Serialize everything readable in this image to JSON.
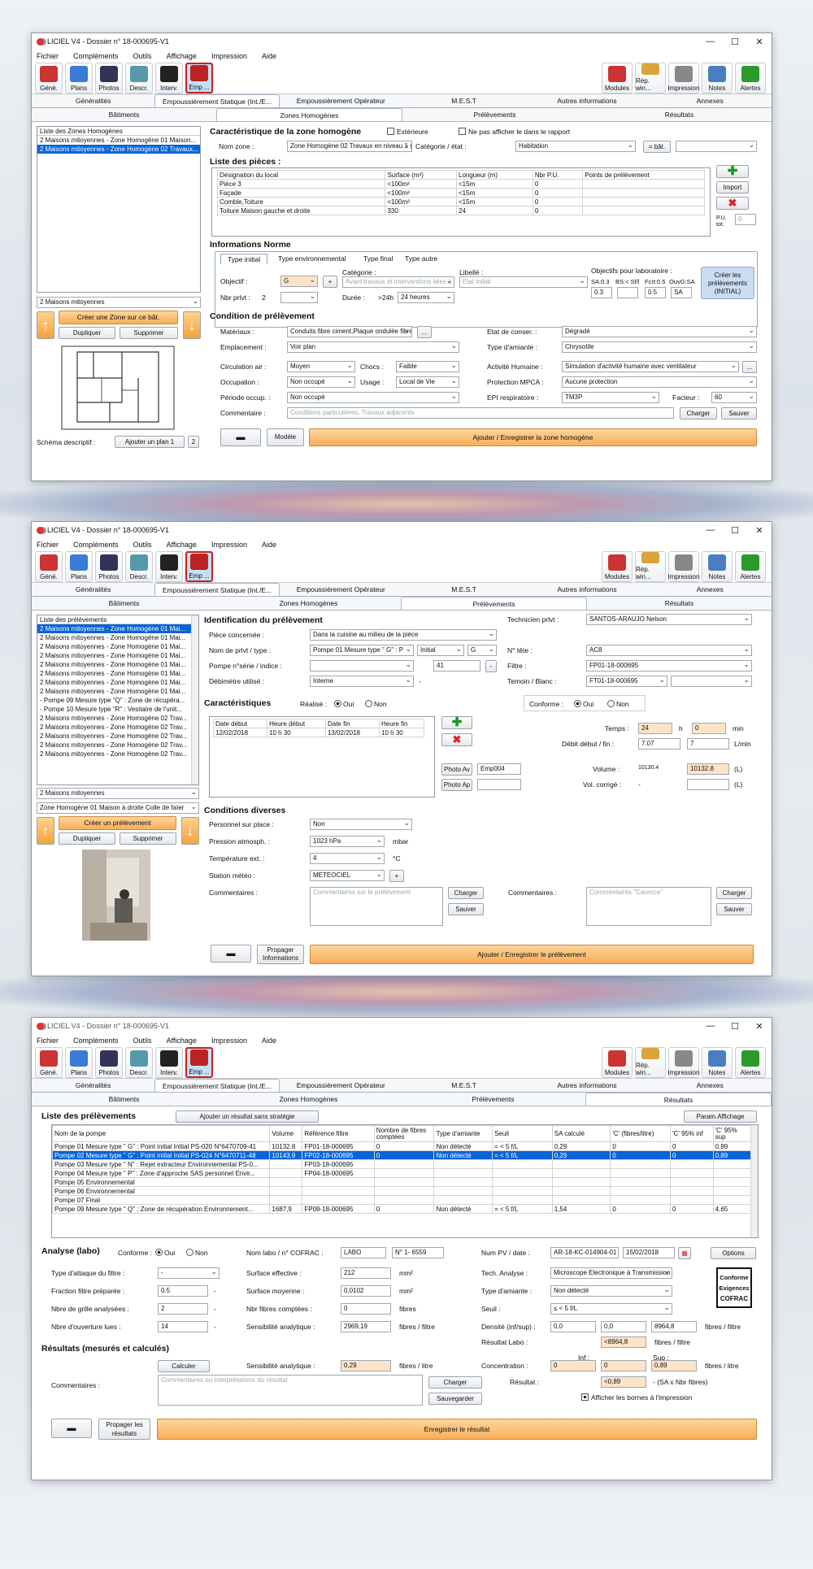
{
  "app": {
    "title": "LICIEL V4 - Dossier n° 18-000695-V1",
    "win_min": "—",
    "win_max": "☐",
    "win_close": "✕",
    "menu": [
      "Fichier",
      "Compléments",
      "Outils",
      "Affichage",
      "Impression",
      "Aide"
    ],
    "toolbar_left": [
      {
        "label": "Géné.",
        "icon": "house-icon",
        "color": "#c33"
      },
      {
        "label": "Plans",
        "icon": "plans-icon",
        "color": "#3a7bd5"
      },
      {
        "label": "Photos",
        "icon": "camera-icon",
        "color": "#335"
      },
      {
        "label": "Descr.",
        "icon": "descr-icon",
        "color": "#59a"
      },
      {
        "label": "Interv.",
        "icon": "phone-icon",
        "color": "#222"
      },
      {
        "label": "Emp ...",
        "icon": "emp-icon",
        "color": "#b22"
      }
    ],
    "toolbar_right": [
      {
        "label": "Modules",
        "icon": "modules-icon",
        "color": "#c33"
      },
      {
        "label": "Rép. win...",
        "icon": "folder-icon",
        "color": "#d9a43a"
      },
      {
        "label": "Impression",
        "icon": "printer-icon",
        "color": "#888"
      },
      {
        "label": "Notes",
        "icon": "notes-icon",
        "color": "#4a7ec0"
      },
      {
        "label": "Alertes",
        "icon": "alert-icon",
        "color": "#2a9a2a"
      }
    ],
    "tabs_main": [
      "Généralités",
      "Empoussièrement Statique (Int./E...",
      "Empoussièrement Opérateur",
      "M.E.S.T",
      "Autres informations",
      "Annexes"
    ],
    "tabs_main3": [
      "Généralités",
      "Empoussièrement Statique (Int./E...",
      "Empoussièrement Opérateur",
      "M.E.S.T",
      "Autres informations",
      "Annexes"
    ],
    "tabs_sub": [
      "Bâtiments",
      "Zones Homogènes",
      "Prélèvements",
      "Résultats"
    ]
  },
  "w1": {
    "zones_header": "Liste des Zones Homogènes",
    "zones": [
      "2 Maisons mitoyennes - Zone Homogène 01 Maison...",
      "2 Maisons mitoyennes - Zone Homogène 02 Travaux..."
    ],
    "bat_select": "2 Maisons mitoyennes",
    "btn_create": "Créer une Zone sur ce bât.",
    "btn_dup": "Dupliquer",
    "btn_del": "Supprimer",
    "schema_label": "Schéma descriptif :",
    "btn_plan": "Ajouter un plan 1",
    "plan_n": "2",
    "btn_modele": "Modèle",
    "h_zone": "Caractéristique de la zone homogène",
    "chk_ext": "Extérieure",
    "chk_noreport": "Ne pas afficher le dans le rapport",
    "lbl_nom": "Nom zone :",
    "nom": "Zone Homogène 02 Travaux en niveau 1 (Conc",
    "lbl_cat": "Catégorie / état :",
    "cat": "Habitation",
    "btn_eq": "= bât.",
    "h_pieces": "Liste des pièces :",
    "pieces_cols": [
      "Désignation du local",
      "Surface (m²)",
      "Longueur (m)",
      "Nbr P.U.",
      "Points de prélèvement"
    ],
    "pieces": [
      [
        "Pièce 3",
        "<100m²",
        "<15m",
        "0",
        ""
      ],
      [
        "Façade",
        "<100m²",
        "<15m",
        "0",
        ""
      ],
      [
        "Comble,Toiture",
        "<100m²",
        "<15m",
        "0",
        ""
      ],
      [
        "Toiture Maison  gauche et droite",
        "330",
        "24",
        "0",
        ""
      ]
    ],
    "btn_import": "Import",
    "pu_tot_label": "P.U. tot.",
    "pu_tot": "0",
    "h_norme": "Informations Norme",
    "norme_tabs": [
      "Type initial",
      "Type environnemental",
      "Type final",
      "Type autre"
    ],
    "lbl_objectif": "Objectif :",
    "objectif": "G",
    "lbl_categorie": "Catégorie :",
    "categorie": "Avant travaux et interventions liées à",
    "lbl_libelle": "Libellé :",
    "libelle": "Etat initial",
    "lbl_objlab": "Objectifs pour laboratoire :",
    "sa_lbl": "SA:0.3",
    "bs_lbl": "BS:< Sf/l",
    "fct_lbl": "Fcrt:0.5",
    "ouv_lbl": "OuvG:SA",
    "sa": "0.3",
    "bs": "",
    "fct": "0.5",
    "ouv": "SA",
    "lbl_nbr": "Nbr prlvt :",
    "nbr": "2",
    "lbl_duree": "Durée :",
    "duree_pre": ">24h",
    "duree": "24 heures",
    "btn_creer_prelev": "Créer les prélèvements (INITIAL)",
    "h_condition": "Condition de prélèvement",
    "lbl_mat": "Matériaux :",
    "mat": "Conduits fibre ciment,Plaque ondulée fibre cir",
    "lbl_etat": "Etat de conser. :",
    "etat": "Dégradé",
    "lbl_empl": "Emplacement :",
    "empl": "Voir plan",
    "lbl_type_am": "Type d'amiante :",
    "type_am": "Chrysotile",
    "lbl_circ": "Circulation air :",
    "circ": "Moyen",
    "lbl_chocs": "Chocs :",
    "chocs": "Faible",
    "lbl_act": "Activité Humaine :",
    "act": "Simulation d'activité humaine avec ventilateur",
    "lbl_occ": "Occupation :",
    "occ": "Non occupé",
    "lbl_usage": "Usage :",
    "usage": "Local de Vie",
    "lbl_prot": "Protection MPCA :",
    "prot": "Aucune protection",
    "lbl_per": "Période occup. :",
    "per": "Non occupé",
    "lbl_epi": "EPI respiratoire :",
    "epi": "TM3P",
    "lbl_fact": "Facteur :",
    "fact": "60",
    "lbl_comm": "Commentaire :",
    "comm_ph": "Conditions particulières, Travaux adjacents",
    "btn_charger": "Charger",
    "btn_sauver": "Sauver",
    "btn_save_zone": "Ajouter / Enregistrer la zone homogène"
  },
  "w2": {
    "list_header": "Liste des prélèvements",
    "prelevs": [
      "2 Maisons mitoyennes - Zone Homogène 01 Mai...",
      "2 Maisons mitoyennes - Zone Homogène 01 Mai...",
      "2 Maisons mitoyennes - Zone Homogène 01 Mai...",
      "2 Maisons mitoyennes - Zone Homogène 01 Mai...",
      "2 Maisons mitoyennes - Zone Homogène 01 Mai...",
      "2 Maisons mitoyennes - Zone Homogène 01 Mai...",
      "2 Maisons mitoyennes - Zone Homogène 01 Mai...",
      "2 Maisons mitoyennes - Zone Homogène 01 Mai...",
      "- Pompe 09 Mesure type \"Q\" : Zone de récupéra...",
      "- Pompe 10 Mesure type \"R\" : Vestiaire de l'unit...",
      "2 Maisons mitoyennes - Zone Homogène 02 Trav...",
      "2 Maisons mitoyennes - Zone Homogène 02 Trav...",
      "2 Maisons mitoyennes - Zone Homogène 02 Trav...",
      "2 Maisons mitoyennes - Zone Homogène 02 Trav...",
      "2 Maisons mitoyennes - Zone Homogène 02 Trav..."
    ],
    "bat_select": "2 Maisons mitoyennes",
    "zone_select": "Zone Homogène 01 Maison à droite Colle de faïer",
    "btn_create": "Créer un prélèvement",
    "btn_dup": "Dupliquer",
    "btn_del": "Supprimer",
    "btn_propag": "Propager Informations",
    "h_ident": "Identification du prélèvement",
    "lbl_piece": "Pièce concernée :",
    "piece": "Dans la cuisine au milieu de la pièce",
    "lbl_nom": "Nom de prlvt / type :",
    "nom": "Pompe 01 Mesure type \" G\" : P",
    "nom_type": "Initial",
    "nom_g": "G",
    "lbl_pompe": "Pompe n°série / indice :",
    "pompe": "",
    "indice": "41",
    "lbl_debit": "Débimètre utilisé :",
    "debit": "Interne",
    "lbl_tech": "Technicien prlvt :",
    "tech": "SANTOS-ARAUJO Nelson",
    "lbl_tete": "N° tête :",
    "tete": "AC8",
    "lbl_filtre": "Filtre :",
    "filtre": "FP01-18-000695",
    "lbl_temoin": "Temoin / Blanc :",
    "temoin": "FT01-18-000695",
    "h_carac": "Caractéristiques",
    "lbl_realise": "Réalisé :",
    "oui": "Oui",
    "non": "Non",
    "lbl_conforme": "Conforme :",
    "date_cols": [
      "Date début",
      "Heure début",
      "Date fin",
      "Heure fin"
    ],
    "dates": [
      "12/02/2018",
      "10 h 30",
      "13/02/2018",
      "10 h 30"
    ],
    "lbl_temps": "Temps :",
    "temps_h": "24",
    "h_unit": "h",
    "temps_min": "0",
    "min_unit": "min",
    "lbl_debit_df": "Débit début / fin :",
    "debit_d": "7.07",
    "debit_f": "7",
    "lmin": "L/min",
    "btn_photo_av": "Photo Av",
    "photo_av": "Emp004",
    "btn_photo_ap": "Photo Ap",
    "photo_ap": "",
    "lbl_volume": "Volume :",
    "volume_small": "10130.4",
    "volume": "10132.8",
    "l_unit": "(L)",
    "lbl_volc": "Vol. corrigé :",
    "volc_dash": "-",
    "volc": "",
    "h_cond": "Conditions diverses",
    "lbl_pers": "Personnel sur place :",
    "pers": "Non",
    "lbl_pres": "Pression atmosph. :",
    "pres": "1023 hPa",
    "mbar": "mbar",
    "lbl_temp": "Température ext. :",
    "temp": "4",
    "degc": "°C",
    "lbl_station": "Station météo :",
    "station": "METEOCIEL",
    "lbl_comm": "Commentaires :",
    "comm_ph": "Commentaires sur le prélèvement",
    "lbl_comm2": "Commentaires :",
    "comm2_ph": "Commentaires \"Carence\"",
    "btn_charger": "Charger",
    "btn_sauver": "Sauver",
    "btn_save": "Ajouter / Enregistrer le prélèvement"
  },
  "w3": {
    "h_list": "Liste des prélèvements",
    "btn_add": "Ajouter un résultat sans stratégie",
    "btn_param": "Param.Affichage",
    "cols": [
      "Nom de la pompe",
      "Volume",
      "Référence filtre",
      "Nombre de fibres comptées",
      "Type d'amiante",
      "Seuil",
      "SA calculé",
      "'C' (fibres/litre)",
      "'C' 95% inf",
      "'C' 95% sup"
    ],
    "rows": [
      [
        "Pompe 01 Mesure type \" G\" : Point initial Initial PS-020 N°6470709-41",
        "10132.8",
        "FP01-18-000695",
        "0",
        "Non détecté",
        "= < 5 f/L",
        "0,29",
        "0",
        "0",
        "0,89"
      ],
      [
        "Pompe 02 Mesure type \" G\" : Point initial Initial PS-024 N°6470711-48",
        "10143.9",
        "FP02-18-000695",
        "0",
        "Non détecté",
        "= < 5 f/L",
        "0,29",
        "0",
        "0",
        "0,89"
      ],
      [
        "Pompe 03 Mesure type \" N\" : Rejet extracteur Environnemental PS-0...",
        "",
        "FP03-18-000695",
        "",
        "",
        "",
        "",
        "",
        "",
        ""
      ],
      [
        "Pompe 04 Mesure type \" P\" : Zone d'approche SAS personnel Envir...",
        "",
        "FP04-18-000695",
        "",
        "",
        "",
        "",
        "",
        "",
        ""
      ],
      [
        "Pompe 05 Environnemental",
        "",
        "",
        "",
        "",
        "",
        "",
        "",
        "",
        ""
      ],
      [
        "Pompe 06 Environnemental",
        "",
        "",
        "",
        "",
        "",
        "",
        "",
        "",
        ""
      ],
      [
        "Pompe 07 Final",
        "",
        "",
        "",
        "",
        "",
        "",
        "",
        "",
        ""
      ],
      [
        "Pompe 09 Mesure type \" Q\" : Zone de récupération Environnement...",
        "1687,9",
        "FP09-18-000695",
        "0",
        "Non détecté",
        "= < 5 f/L",
        "1,54",
        "0",
        "0",
        "4,65"
      ]
    ],
    "h_analyse": "Analyse (labo)",
    "lbl_conforme": "Conforme :",
    "oui": "Oui",
    "non": "Non",
    "lbl_nomlabo": "Nom labo / n° COFRAC :",
    "nomlabo": "LABO",
    "cofrac": "N° 1- 6559",
    "lbl_numpv": "Num PV / date :",
    "numpv": "AR-18-KC-014904-01",
    "pvdate": "15/02/2018",
    "btn_options": "Options",
    "lbl_typeatt": "Type d'attaque du filtre :",
    "typeatt": "-",
    "lbl_surfeff": "Surface effective :",
    "surfeff": "212",
    "mm2": "mm²",
    "lbl_tech": "Tech. Analyse :",
    "tech": "Microscope Electronique à Transmission Anal",
    "lbl_fraction": "Fraction filtre préparée :",
    "fraction": "0.5",
    "dash": "-",
    "lbl_surfmoy": "Surface moyenne :",
    "surfmoy": "0,0102",
    "lbl_typeam": "Type d'amiante :",
    "typeam": "Non détecté",
    "lbl_grilles": "Nbre de grille analysées :",
    "grilles": "2",
    "lbl_nbrfib": "Nbr fibres comptées :",
    "nbrfib": "0",
    "fibres": "fibres",
    "lbl_seuil": "Seuil :",
    "seuil": "≤ < 5 f/L",
    "lbl_ouvert": "Nbre d'ouverture lues :",
    "ouvert": "14",
    "lbl_sens": "Sensibilité analytique :",
    "sens": "2969,19",
    "fibfiltre": "fibres / filtre",
    "lbl_dens": "Densité (inf/sup) :",
    "dens1": "0,0",
    "dens2": "0,0",
    "dens3": "8964,8",
    "lbl_reslabo": "Résultat Labo :",
    "reslabo": "<8964,8",
    "cofrac_logo": [
      "Conforme",
      "Exigences",
      "COFRAC"
    ],
    "h_res": "Résultats (mesurés et calculés)",
    "btn_calc": "Calculer",
    "lbl_sens2": "Sensibilité analytique :",
    "sens2": "0,29",
    "fiblitre": "fibres / litre",
    "lbl_inf": "Inf :",
    "lbl_sup": "Sup :",
    "lbl_conc": "Concentration :",
    "conc1": "0",
    "conc2": "0",
    "conc3": "0,89",
    "lbl_result": "Résultat :",
    "result": "<0,89",
    "result_note": "- (SA x Nbr fibres)",
    "chk_bornes": "Afficher les bornes à l'impression",
    "lbl_comm": "Commentaires :",
    "comm_ph": "Commentaires ou interprétations du résultat",
    "btn_charger": "Charger",
    "btn_sauv": "Sauvegarder",
    "btn_propag": "Propager les résultats",
    "btn_save": "Enregistrer le résultat"
  }
}
